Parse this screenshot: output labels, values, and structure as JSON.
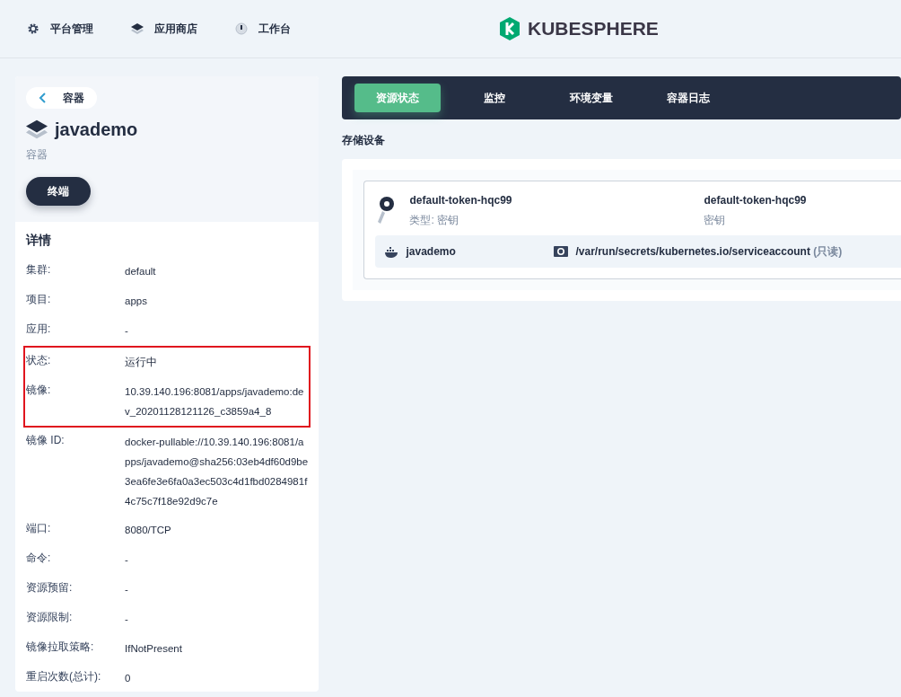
{
  "top_nav": {
    "items": [
      {
        "label": "平台管理",
        "kind": "gear"
      },
      {
        "label": "应用商店",
        "kind": "layers"
      },
      {
        "label": "工作台",
        "kind": "dial"
      }
    ],
    "logo": "KUBESPHERE"
  },
  "sidebar": {
    "back_label": "容器",
    "name": "javademo",
    "type": "容器",
    "terminal_button": "终端",
    "details_title": "详情",
    "details": [
      {
        "label": "集群:",
        "value": "default",
        "highlighted": false
      },
      {
        "label": "项目:",
        "value": "apps",
        "highlighted": false
      },
      {
        "label": "应用:",
        "value": "-",
        "highlighted": false
      },
      {
        "label": "状态:",
        "value": "运行中",
        "highlighted": true
      },
      {
        "label": "镜像:",
        "value": "10.39.140.196:8081/apps/javademo:dev_20201128121126_c3859a4_8",
        "highlighted": true
      },
      {
        "label": "镜像 ID:",
        "value": "docker-pullable://10.39.140.196:8081/apps/javademo@sha256:03eb4df60d9be3ea6fe3e6fa0a3ec503c4d1fbd0284981f4c75c7f18e92d9c7e",
        "highlighted": false
      },
      {
        "label": "端口:",
        "value": "8080/TCP",
        "highlighted": false
      },
      {
        "label": "命令:",
        "value": "-",
        "highlighted": false
      },
      {
        "label": "资源预留:",
        "value": "-",
        "highlighted": false
      },
      {
        "label": "资源限制:",
        "value": "-",
        "highlighted": false
      },
      {
        "label": "镜像拉取策略:",
        "value": "IfNotPresent",
        "highlighted": false
      },
      {
        "label": "重启次数(总计):",
        "value": "0",
        "highlighted": false
      }
    ]
  },
  "tabs": [
    {
      "label": "资源状态",
      "selected": true
    },
    {
      "label": "监控",
      "selected": false
    },
    {
      "label": "环境变量",
      "selected": false
    },
    {
      "label": "容器日志",
      "selected": false
    }
  ],
  "storage": {
    "title": "存储设备",
    "volumes": [
      {
        "name": "default-token-hqc99",
        "type_label": "类型: 密钥",
        "secret_name": "default-token-hqc99",
        "secret_type": "密钥",
        "mounts": [
          {
            "container": "javademo",
            "path": "/var/run/secrets/kubernetes.io/serviceaccount",
            "mode": "(只读)"
          }
        ]
      }
    ]
  }
}
